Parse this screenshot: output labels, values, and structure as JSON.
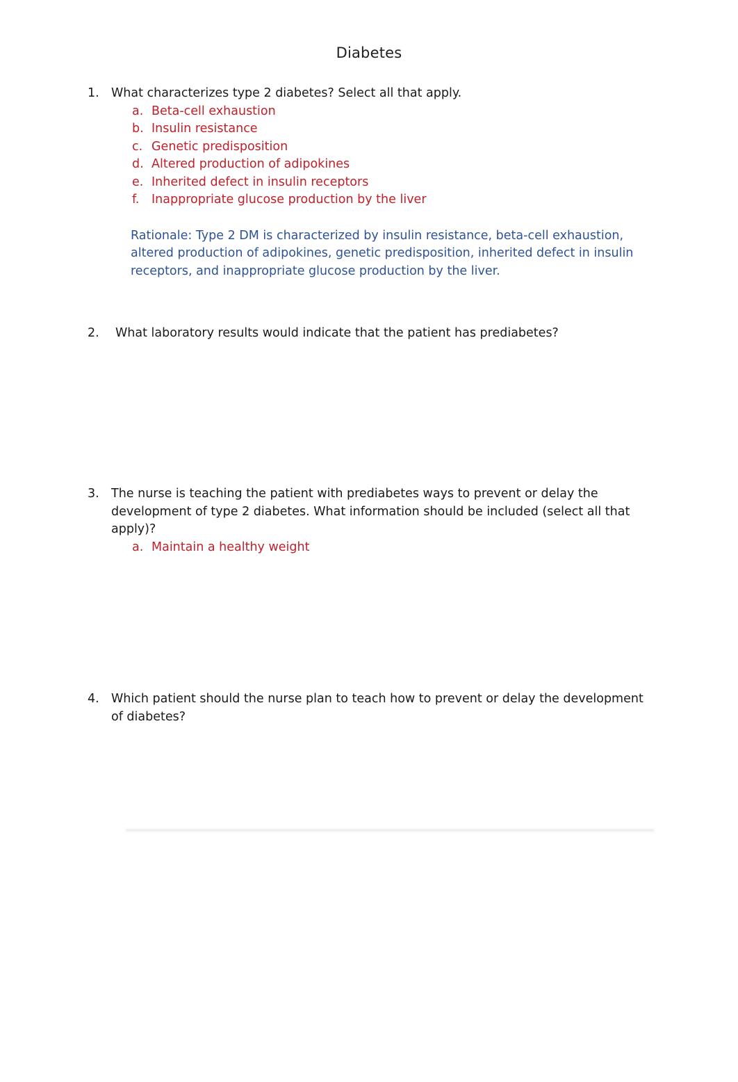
{
  "document": {
    "title": "Diabetes",
    "colors": {
      "body_text": "#1a1a1a",
      "answer_red": "#C0202A",
      "rationale_blue": "#2E5395",
      "page_background": "#ffffff"
    }
  },
  "questions": [
    {
      "number": "1.",
      "prompt": "What characterizes type 2 diabetes? Select all that apply.",
      "options": [
        {
          "letter": "a.",
          "text": "Beta-cell exhaustion"
        },
        {
          "letter": "b.",
          "text": "Insulin resistance"
        },
        {
          "letter": "c.",
          "text": "Genetic predisposition"
        },
        {
          "letter": "d.",
          "text": "Altered production of adipokines"
        },
        {
          "letter": "e.",
          "text": "Inherited defect in insulin receptors"
        },
        {
          "letter": "f.",
          "text": "Inappropriate glucose production by the liver"
        }
      ],
      "rationale": "Rationale: Type 2 DM is characterized by insulin resistance, beta-cell exhaustion, altered production of adipokines, genetic predisposition, inherited defect in insulin receptors, and inappropriate glucose production by the liver."
    },
    {
      "number": "2.",
      "prompt": "What laboratory results would indicate that the patient has prediabetes?",
      "options": [],
      "rationale": ""
    },
    {
      "number": "3.",
      "prompt": "The nurse is teaching the patient with prediabetes ways to prevent or delay the development of type 2 diabetes. What information should be included (select all that apply)?",
      "options": [
        {
          "letter": "a.",
          "text": "Maintain a healthy weight"
        }
      ],
      "rationale": ""
    },
    {
      "number": "4.",
      "prompt": "Which patient should the nurse plan to teach how to prevent or delay the development of diabetes?",
      "options": [],
      "rationale": ""
    }
  ]
}
